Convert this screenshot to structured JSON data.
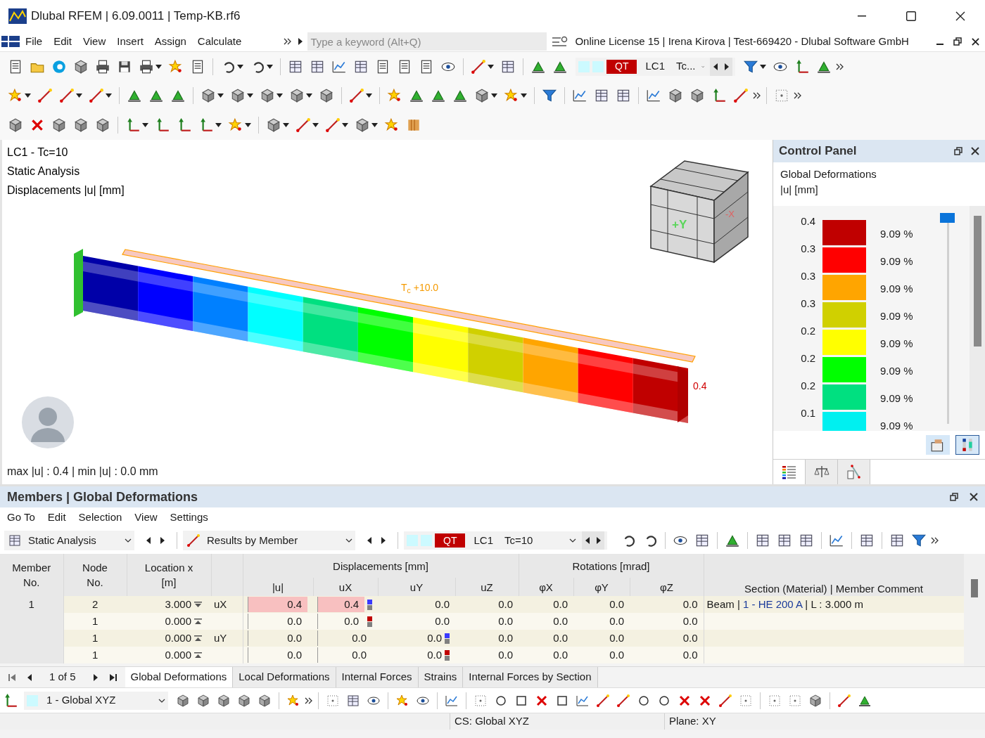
{
  "window": {
    "title": "Dlubal RFEM | 6.09.0011 | Temp-KB.rf6"
  },
  "menu": [
    "File",
    "Edit",
    "View",
    "Insert",
    "Assign",
    "Calculate"
  ],
  "search": {
    "placeholder": "Type a keyword (Alt+Q)"
  },
  "license": "Online License 15 | Irena Kirova | Test-669420 - Dlubal Software GmbH",
  "toolbar_case": {
    "badge": "QT",
    "case": "LC1",
    "combo": "Tc..."
  },
  "viewport": {
    "info": [
      "LC1 - Tc=10",
      "Static Analysis",
      "Displacements |u| [mm]"
    ],
    "load_label": "T$_{c}$ +10.0",
    "max_label": "0.4",
    "cube_labels": [
      "+Y",
      "-X"
    ],
    "summary": "max |u| : 0.4 | min |u| : 0.0 mm"
  },
  "control_panel": {
    "title": "Control Panel",
    "heading": "Global Deformations",
    "unit": "|u| [mm]",
    "legend": [
      {
        "value": "0.4",
        "color": "#c00000",
        "share": "9.09 %"
      },
      {
        "value": "0.3",
        "color": "#ff0000",
        "share": "9.09 %"
      },
      {
        "value": "0.3",
        "color": "#ffa500",
        "share": "9.09 %"
      },
      {
        "value": "0.3",
        "color": "#d0d000",
        "share": "9.09 %"
      },
      {
        "value": "0.2",
        "color": "#ffff00",
        "share": "9.09 %"
      },
      {
        "value": "0.2",
        "color": "#00ff00",
        "share": "9.09 %"
      },
      {
        "value": "0.2",
        "color": "#00e080",
        "share": "9.09 %"
      },
      {
        "value": "0.1",
        "color": "#00f0f0",
        "share": "9.09 %"
      }
    ],
    "slider": {
      "level": 0
    },
    "tabs": [
      {
        "kind": "legend",
        "selected": true
      },
      {
        "kind": "balance",
        "selected": false
      },
      {
        "kind": "pointer",
        "selected": false
      }
    ]
  },
  "results": {
    "title": "Members | Global Deformations",
    "menu": [
      "Go To",
      "Edit",
      "Selection",
      "View",
      "Settings"
    ],
    "analysis": "Static Analysis",
    "results_by": "Results by Member",
    "case": {
      "badge": "QT",
      "case": "LC1",
      "combo": "Tc=10"
    },
    "table": {
      "groups": [
        "Displacements [mm]",
        "Rotations [mrad]"
      ],
      "columns": [
        "Member No.",
        "Node No.",
        "Location x [m]",
        "|u|",
        "uX",
        "uY",
        "uZ",
        "φX",
        "φY",
        "φZ",
        "Section (Material) | Member Comment"
      ],
      "rows": [
        {
          "member": "1",
          "node": "2",
          "location": "3.000",
          "kind": "max",
          "component": "uX",
          "u": "0.4",
          "ux": "0.4",
          "uy": "0.0",
          "uz": "0.0",
          "px": "0.0",
          "py": "0.0",
          "pz": "0.0",
          "highlight": true,
          "marker": {
            "kind": "ux",
            "color": "#3a3aff"
          },
          "comment": [
            "Beam | ",
            "1 - HE 200 A",
            " | L : 3.000 m"
          ]
        },
        {
          "member": "",
          "node": "1",
          "location": "0.000",
          "kind": "min",
          "component": "",
          "u": "0.0",
          "ux": "0.0",
          "uy": "0.0",
          "uz": "0.0",
          "px": "0.0",
          "py": "0.0",
          "pz": "0.0",
          "highlight": false,
          "marker": {
            "kind": "ux",
            "color": "#c00000"
          }
        },
        {
          "member": "",
          "node": "1",
          "location": "0.000",
          "kind": "min",
          "component": "uY",
          "u": "0.0",
          "ux": "0.0",
          "uy": "0.0",
          "uz": "0.0",
          "px": "0.0",
          "py": "0.0",
          "pz": "0.0",
          "highlight": false,
          "marker": {
            "kind": "uy",
            "color": "#3a3aff"
          }
        },
        {
          "member": "",
          "node": "1",
          "location": "0.000",
          "kind": "min",
          "component": "",
          "u": "0.0",
          "ux": "0.0",
          "uy": "0.0",
          "uz": "0.0",
          "px": "0.0",
          "py": "0.0",
          "pz": "0.0",
          "highlight": false,
          "marker": {
            "kind": "uy",
            "color": "#c00000"
          }
        }
      ]
    },
    "pager": "1 of 5",
    "tabs": [
      {
        "label": "Global Deformations",
        "selected": true
      },
      {
        "label": "Local Deformations",
        "selected": false
      },
      {
        "label": "Internal Forces",
        "selected": false
      },
      {
        "label": "Strains",
        "selected": false
      },
      {
        "label": "Internal Forces by Section",
        "selected": false
      }
    ]
  },
  "coordinate_system": "1 - Global XYZ",
  "status_bar": [
    "CS: Global XYZ",
    "Plane: XY"
  ]
}
